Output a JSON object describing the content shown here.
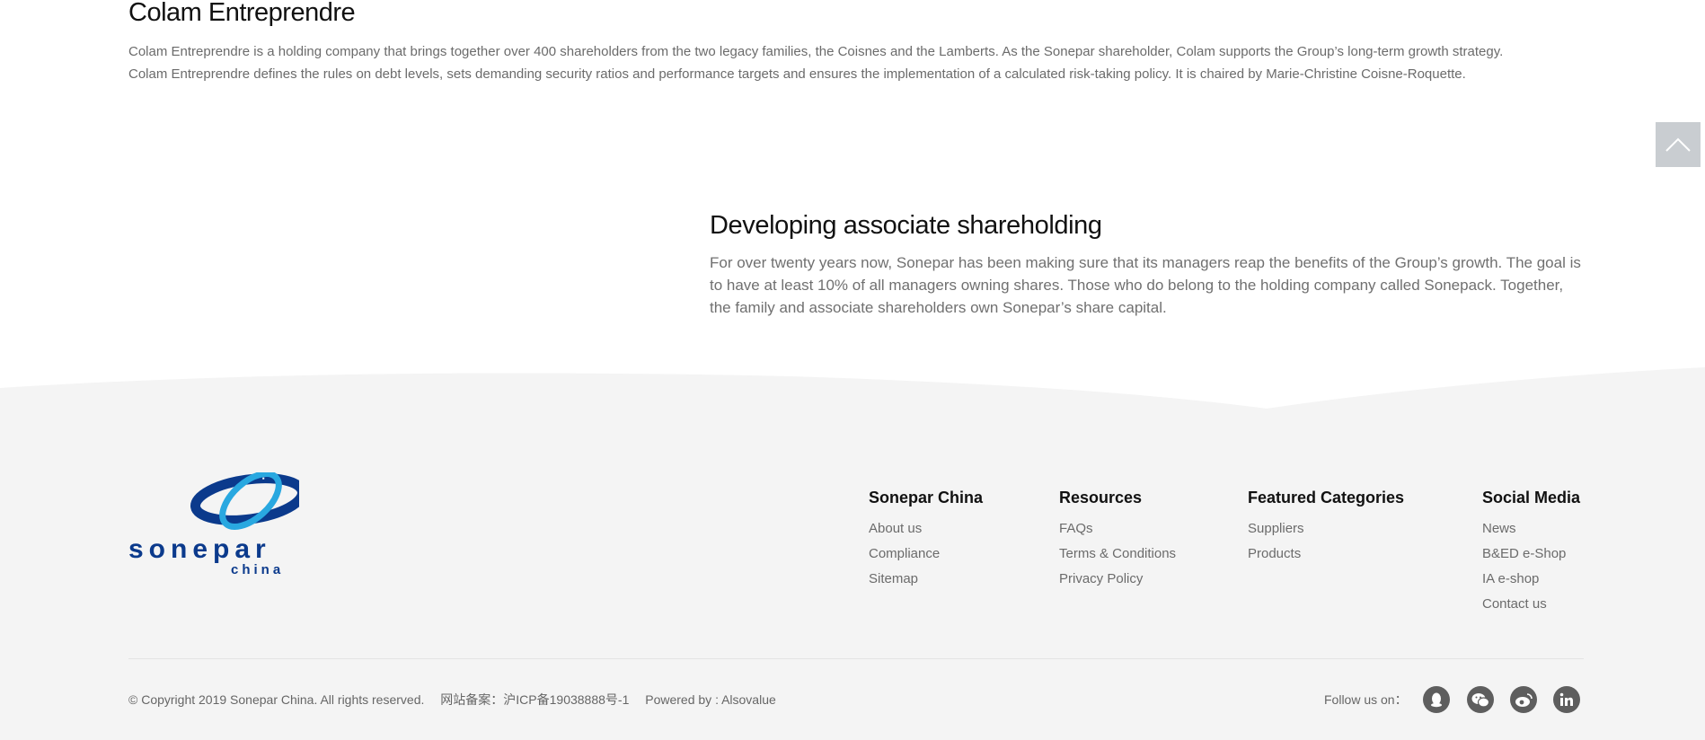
{
  "colam": {
    "title": "Colam Entreprendre",
    "line1": "Colam Entreprendre is a holding company that brings together over 400 shareholders from the two legacy families, the Coisnes and the Lamberts. As the Sonepar shareholder, Colam supports the Group’s long-term growth strategy.",
    "line2": "Colam Entreprendre defines the rules on debt levels, sets demanding security ratios and performance targets and ensures the implementation of a calculated risk-taking policy. It is chaired by Marie-Christine Coisne-Roquette."
  },
  "associate": {
    "title": "Developing associate shareholding",
    "body": "For over twenty years now, Sonepar has been making sure that its managers reap the benefits of the Group’s growth. The goal is to have at least 10% of all managers owning shares. Those who do belong to the holding company called Sonepack. Together, the family and associate shareholders own Sonepar’s share capital."
  },
  "footer": {
    "logo": {
      "wordmark": "sonepar",
      "sub": "china"
    },
    "columns": [
      {
        "title": "Sonepar China",
        "links": [
          "About us",
          "Compliance",
          "Sitemap"
        ]
      },
      {
        "title": "Resources",
        "links": [
          "FAQs",
          "Terms & Conditions",
          "Privacy Policy"
        ]
      },
      {
        "title": "Featured Categories",
        "links": [
          "Suppliers",
          "Products"
        ]
      },
      {
        "title": "Social Media",
        "links": [
          "News",
          "B&ED e-Shop",
          "IA e-shop",
          "Contact us"
        ]
      }
    ],
    "copyright": "© Copyright 2019 Sonepar China. All rights reserved.",
    "icp": "网站备案：沪ICP备19038888号-1",
    "powered": "Powered by : Alsovalue",
    "follow_label": "Follow us on：",
    "social_icons": [
      "qq-icon",
      "wechat-icon",
      "weibo-icon",
      "linkedin-icon"
    ]
  },
  "colors": {
    "footer_bg": "#f4f4f4",
    "logo_blue": "#0b3a8c",
    "logo_light_blue": "#29a8e0",
    "back_to_top": "#c9cdd1",
    "social_icon_bg": "#5e5e5e"
  }
}
